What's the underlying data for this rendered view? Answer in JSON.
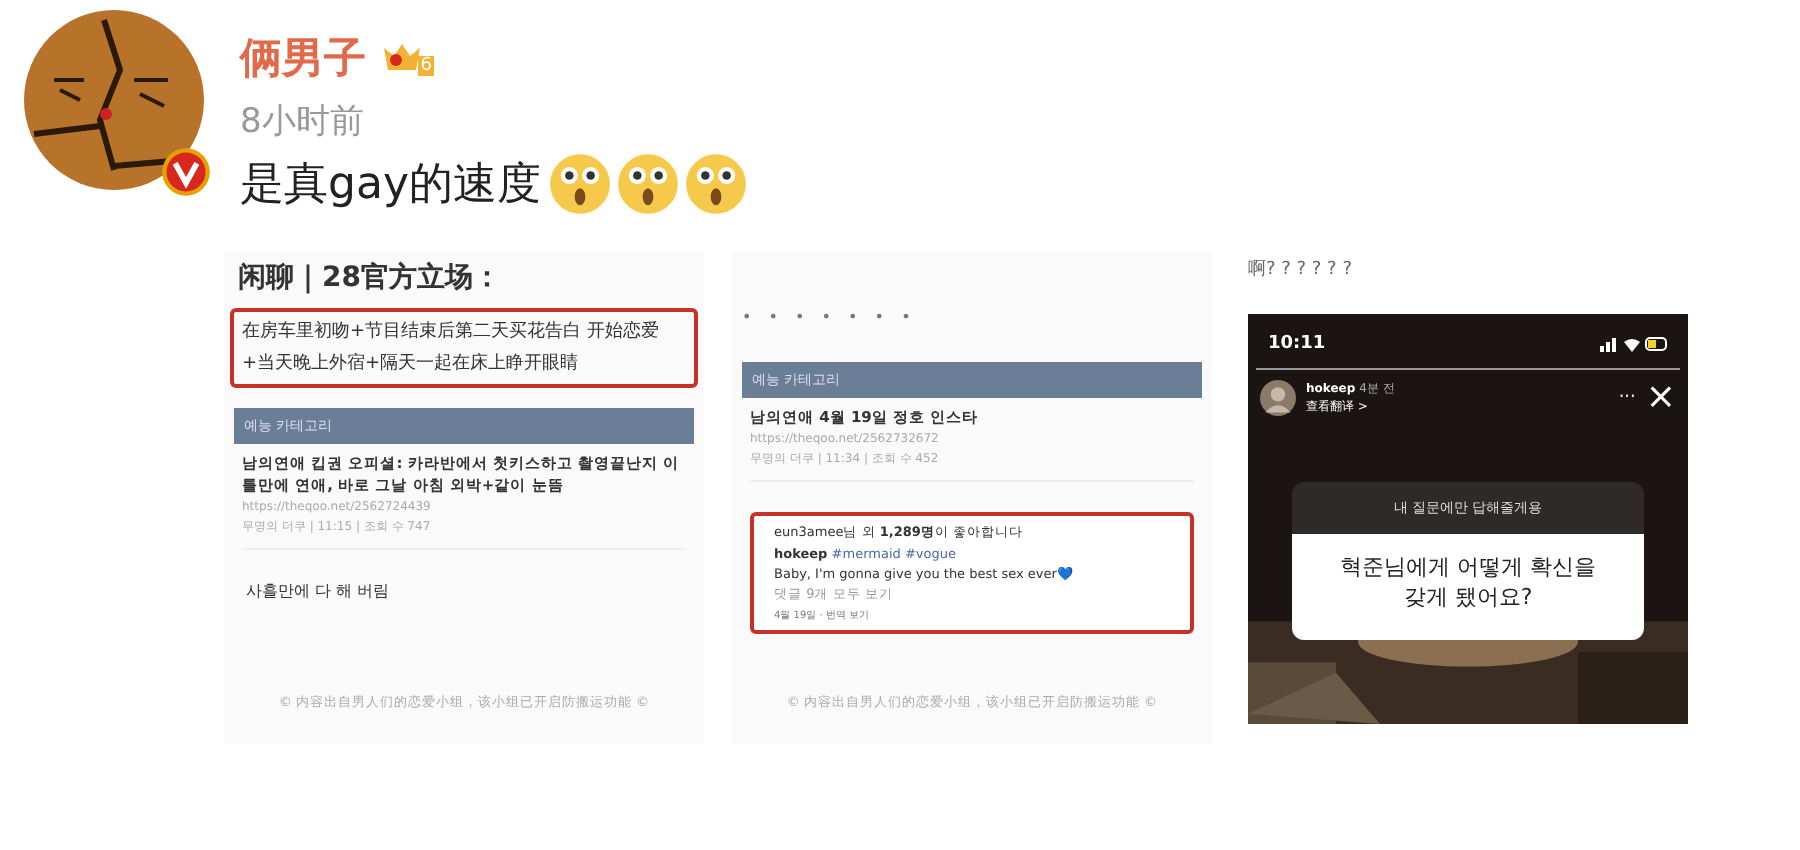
{
  "post": {
    "author": "俩男子",
    "member_level": "6",
    "verified": true,
    "time": "8小时前",
    "text": "是真gay的速度"
  },
  "images": [
    {
      "kind": "forum",
      "title": "闲聊｜28官方立场：",
      "highlight": "在房车里初吻+节目结束后第二天买花告白 开始恋爱+当天晚上外宿+隔天一起在床上睁开眼睛",
      "category": "예능 카테고리",
      "article_title": "남의연애 킵권 오피셜: 카라반에서 첫키스하고 촬영끝난지 이틀만에 연애, 바로 그날 아침 외박+같이 눈뜸",
      "url": "https://theqoo.net/2562724439",
      "meta": "무명의 더쿠 | 11:15 | 조회 수 747",
      "comment": "사흘만에 다 해 버림",
      "footer": "© 内容出自男人们的恋爱小组，该小组已开启防搬运功能 ©"
    },
    {
      "kind": "forum_post",
      "dots": "• • • • • • •",
      "category": "예능 카테고리",
      "article_title": "남의연애 4월 19일 정호 인스타",
      "url": "https://theqoo.net/2562732672",
      "meta": "무명의 더쿠 | 11:34 | 조회 수 452",
      "likes": "eun3amee님 외 **1,289명**이 좋아합니다",
      "caption_user": "hokeep",
      "caption_tags": "#mermaid #vogue",
      "caption": "Baby, I'm gonna give you the best sex ever💙",
      "comments_link": "댓글 9개 모두 보기",
      "date": "4월 19일 · 번역 보기",
      "footer": "© 内容出自男人们的恋爱小组，该小组已开启防搬运功能 ©"
    },
    {
      "kind": "story",
      "caption_above": "啊? ? ? ? ? ?",
      "clock": "10:11",
      "user": "hokeep",
      "age": "4분 전",
      "translate": "查看翻译 >",
      "question_header": "내 질문에만 답해줄게용",
      "question": "혁준님에게 어떻게 확신을 갖게 됐어요?",
      "close": "×",
      "more": "···"
    }
  ]
}
